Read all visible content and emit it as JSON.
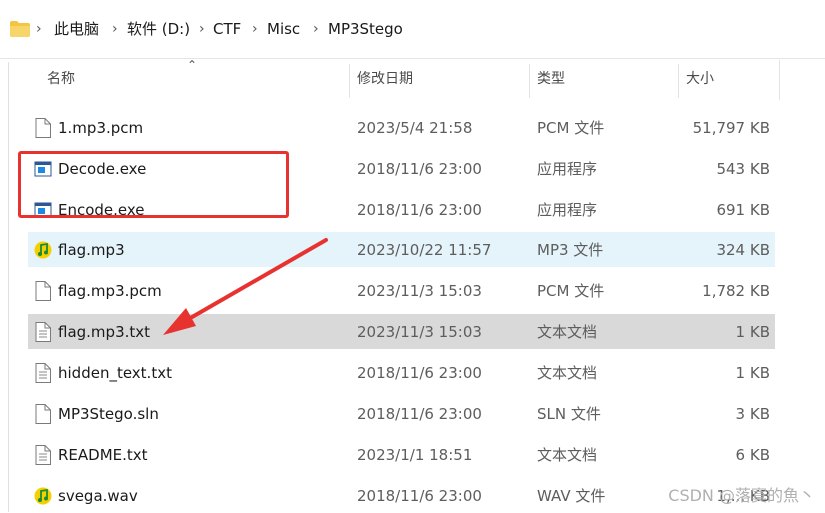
{
  "breadcrumb": {
    "items": [
      "此电脑",
      "软件 (D:)",
      "CTF",
      "Misc",
      "MP3Stego"
    ]
  },
  "columns": {
    "name": "名称",
    "date": "修改日期",
    "type": "类型",
    "size": "大小"
  },
  "files": [
    {
      "name": "1.mp3.pcm",
      "date": "2023/5/4 21:58",
      "type": "PCM 文件",
      "size": "51,797 KB",
      "icon": "file-icon"
    },
    {
      "name": "Decode.exe",
      "date": "2018/11/6 23:00",
      "type": "应用程序",
      "size": "543 KB",
      "icon": "exe-icon"
    },
    {
      "name": "Encode.exe",
      "date": "2018/11/6 23:00",
      "type": "应用程序",
      "size": "691 KB",
      "icon": "exe-icon"
    },
    {
      "name": "flag.mp3",
      "date": "2023/10/22 11:57",
      "type": "MP3 文件",
      "size": "324 KB",
      "icon": "music-icon"
    },
    {
      "name": "flag.mp3.pcm",
      "date": "2023/11/3 15:03",
      "type": "PCM 文件",
      "size": "1,782 KB",
      "icon": "file-icon"
    },
    {
      "name": "flag.mp3.txt",
      "date": "2023/11/3 15:03",
      "type": "文本文档",
      "size": "1 KB",
      "icon": "text-file-icon"
    },
    {
      "name": "hidden_text.txt",
      "date": "2018/11/6 23:00",
      "type": "文本文档",
      "size": "1 KB",
      "icon": "text-file-icon"
    },
    {
      "name": "MP3Stego.sln",
      "date": "2018/11/6 23:00",
      "type": "SLN 文件",
      "size": "3 KB",
      "icon": "file-icon"
    },
    {
      "name": "README.txt",
      "date": "2023/1/1 18:51",
      "type": "文本文档",
      "size": "6 KB",
      "icon": "text-file-icon"
    },
    {
      "name": "svega.wav",
      "date": "2018/11/6 23:00",
      "type": "WAV 文件",
      "size": "1,... KB",
      "icon": "music-icon"
    }
  ],
  "watermark": "CSDN @落寞的魚丶",
  "colors": {
    "selected_row": "#e5f3fb",
    "hover_row": "#d9d9d9",
    "annotation_red": "#e8322f",
    "folder_yellow": "#f4c542"
  }
}
